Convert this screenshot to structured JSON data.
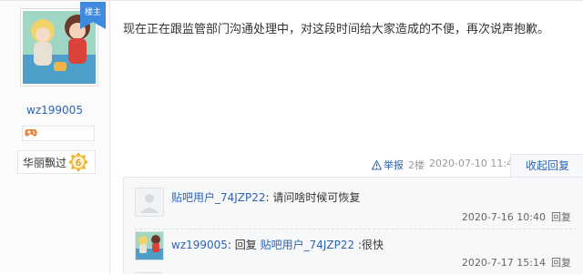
{
  "author": {
    "username": "wz199005",
    "ribbon_label": "楼主",
    "level_name": "华丽飘过",
    "level_number": "6"
  },
  "post": {
    "text": "现在正在跟监管部门沟通处理中，对这段时间给大家造成的不便，再次说声抱歉。",
    "report_label": "举报",
    "floor": "2楼",
    "date": "2020-07-10 11:41",
    "collapse_label": "收起回复"
  },
  "replies": [
    {
      "user": "贴吧用户_74JZP22",
      "separator": ": ",
      "text": "请问啥时候可恢复",
      "time": "2020-7-16 10:40",
      "reply_label": "回复"
    },
    {
      "user": "wz199005",
      "separator": ": ",
      "prefix": "回复 ",
      "mention": "贴吧用户_74JZP22",
      "text": " :很快",
      "time": "2020-7-17 15:14",
      "reply_label": "回复"
    }
  ],
  "colors": {
    "link": "#2d64b3",
    "ribbon": "#3d8ae0"
  }
}
